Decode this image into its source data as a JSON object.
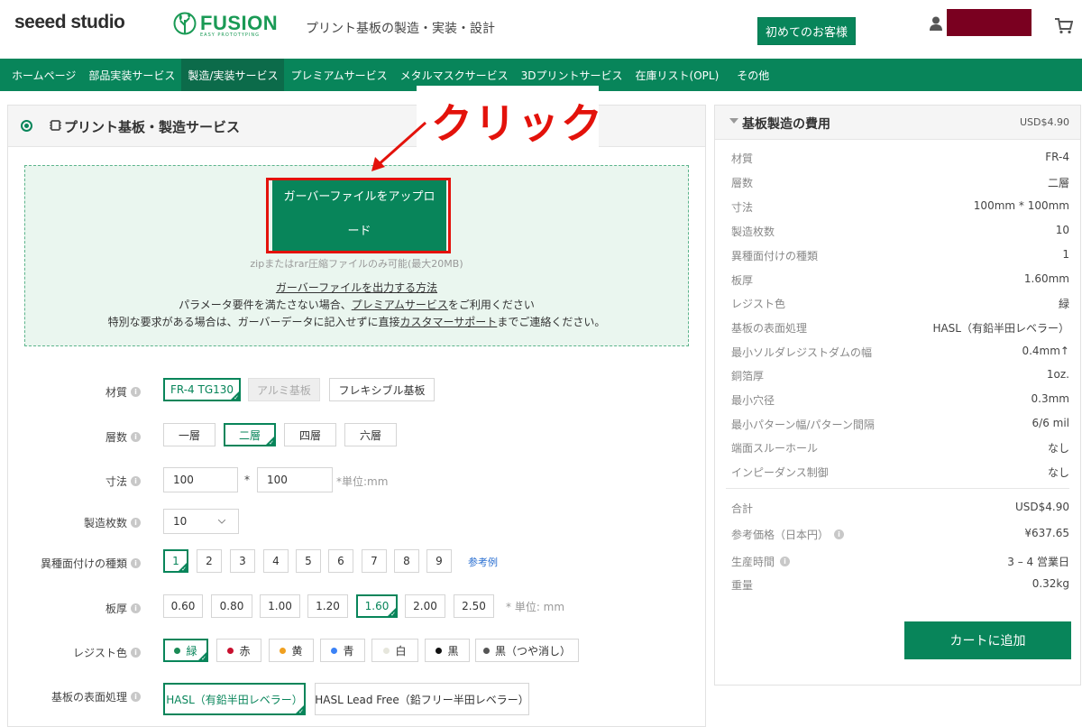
{
  "header": {
    "logo_seeed_a": "seee",
    "logo_seeed_b": "d studio",
    "logo_fusion": "FUSION",
    "logo_fusion_sub": "EASY PROTOTYPING",
    "tagline": "プリント基板の製造・実装・設計",
    "first_customer": "初めてのお客様"
  },
  "nav": [
    "ホームページ",
    "部品実装サービス",
    "製造/実装サービス",
    "プレミアムサービス",
    "メタルマスクサービス",
    "3Dプリントサービス",
    "在庫リスト(OPL)",
    "その他"
  ],
  "panel": {
    "title": "プリント基板・製造サービス",
    "upload_button": "ガーバーファイルをアップロード",
    "upload_note": "zipまたはrar圧縮ファイルのみ可能(最大20MB)",
    "gerber_howto": "ガーバーファイルを出力する方法",
    "line2_a": "パラメータ要件を満たさない場合、",
    "line2_link": "プレミアムサービス",
    "line2_b": "をご利用ください",
    "line3_a": "特別な要求がある場合は、ガーバーデータに記入せずに直接",
    "line3_link": "カスタマーサポート",
    "line3_b": "までご連絡ください。"
  },
  "annotation": {
    "callout": "クリック"
  },
  "form": {
    "material": {
      "label": "材質",
      "options": [
        "FR-4 TG130",
        "アルミ基板",
        "フレキシブル基板"
      ]
    },
    "layers": {
      "label": "層数",
      "options": [
        "一層",
        "二層",
        "四層",
        "六層"
      ]
    },
    "size": {
      "label": "寸法",
      "width": "100",
      "times": "*",
      "height": "100",
      "unit": "*単位:mm"
    },
    "quantity": {
      "label": "製造枚数",
      "value": "10"
    },
    "designs": {
      "label": "異種面付けの種類",
      "options": [
        "1",
        "2",
        "3",
        "4",
        "5",
        "6",
        "7",
        "8",
        "9"
      ],
      "example": "参考例"
    },
    "thickness": {
      "label": "板厚",
      "options": [
        "0.60",
        "0.80",
        "1.00",
        "1.20",
        "1.60",
        "2.00",
        "2.50"
      ],
      "unit": "* 単位: mm"
    },
    "resist": {
      "label": "レジスト色",
      "options": [
        "緑",
        "赤",
        "黄",
        "青",
        "白",
        "黒",
        "黒（つや消し）"
      ]
    },
    "finish": {
      "label": "基板の表面処理",
      "options": [
        "HASL（有鉛半田レベラー）",
        "HASL Lead Free（鉛フリー半田レベラー）"
      ]
    }
  },
  "summary": {
    "title": "基板製造の費用",
    "price": "USD$4.90",
    "specs": [
      [
        "材質",
        "FR-4"
      ],
      [
        "層数",
        "二層"
      ],
      [
        "寸法",
        "100mm * 100mm"
      ],
      [
        "製造枚数",
        "10"
      ],
      [
        "異種面付けの種類",
        "1"
      ],
      [
        "板厚",
        "1.60mm"
      ],
      [
        "レジスト色",
        "緑"
      ],
      [
        "基板の表面処理",
        "HASL（有鉛半田レベラー）"
      ],
      [
        "最小ソルダレジストダムの幅",
        "0.4mm↑"
      ],
      [
        "銅箔厚",
        "1oz."
      ],
      [
        "最小穴径",
        "0.3mm"
      ],
      [
        "最小パターン幅/パターン間隔",
        "6/6 mil"
      ],
      [
        "端面スルーホール",
        "なし"
      ],
      [
        "インピーダンス制御",
        "なし"
      ]
    ],
    "totals": [
      [
        "合計",
        "USD$4.90"
      ],
      [
        "参考価格（日本円）",
        "¥637.65"
      ],
      [
        "生産時間",
        "3 – 4 営業日"
      ],
      [
        "重量",
        "0.32kg"
      ]
    ],
    "add_to_cart": "カートに追加"
  },
  "colors": {
    "brand_green": "#08855a",
    "highlight_red": "#e3120b",
    "resist_dots": [
      "#1a8a55",
      "#c8102e",
      "#f0a020",
      "#3b82f6",
      "#e6e6dc",
      "#111111",
      "#555555"
    ]
  }
}
